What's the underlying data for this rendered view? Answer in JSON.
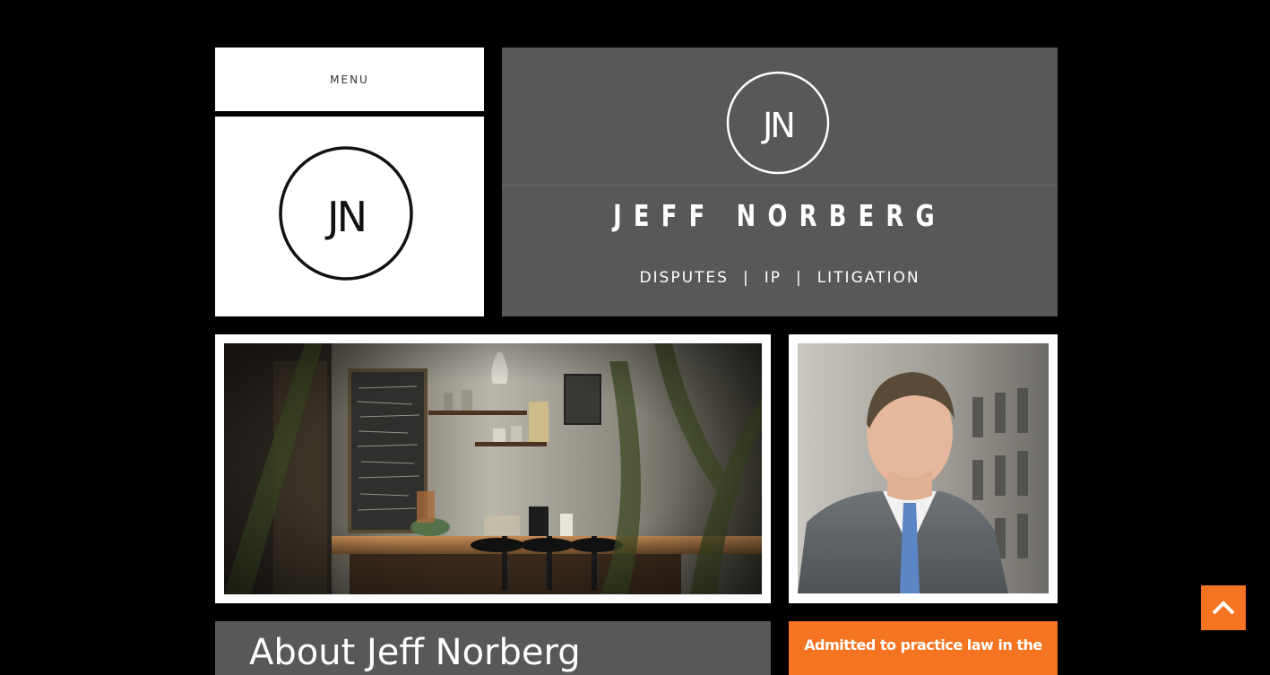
{
  "nav": {
    "menu_label": "MENU"
  },
  "logo": {
    "monogram": "JN"
  },
  "hero": {
    "monogram": "JN",
    "name": "JEFF NORBERG",
    "tagline": [
      "DISPUTES",
      "IP",
      "LITIGATION"
    ],
    "tagline_separator": "|"
  },
  "about": {
    "title": "About Jeff Norberg"
  },
  "admitted": {
    "text": "Admitted to practice law in the"
  },
  "scroll_top": {
    "icon": "chevron-up-icon"
  },
  "colors": {
    "background": "#000000",
    "panel_gray": "#595857",
    "accent_orange": "#f47421",
    "white": "#ffffff"
  }
}
